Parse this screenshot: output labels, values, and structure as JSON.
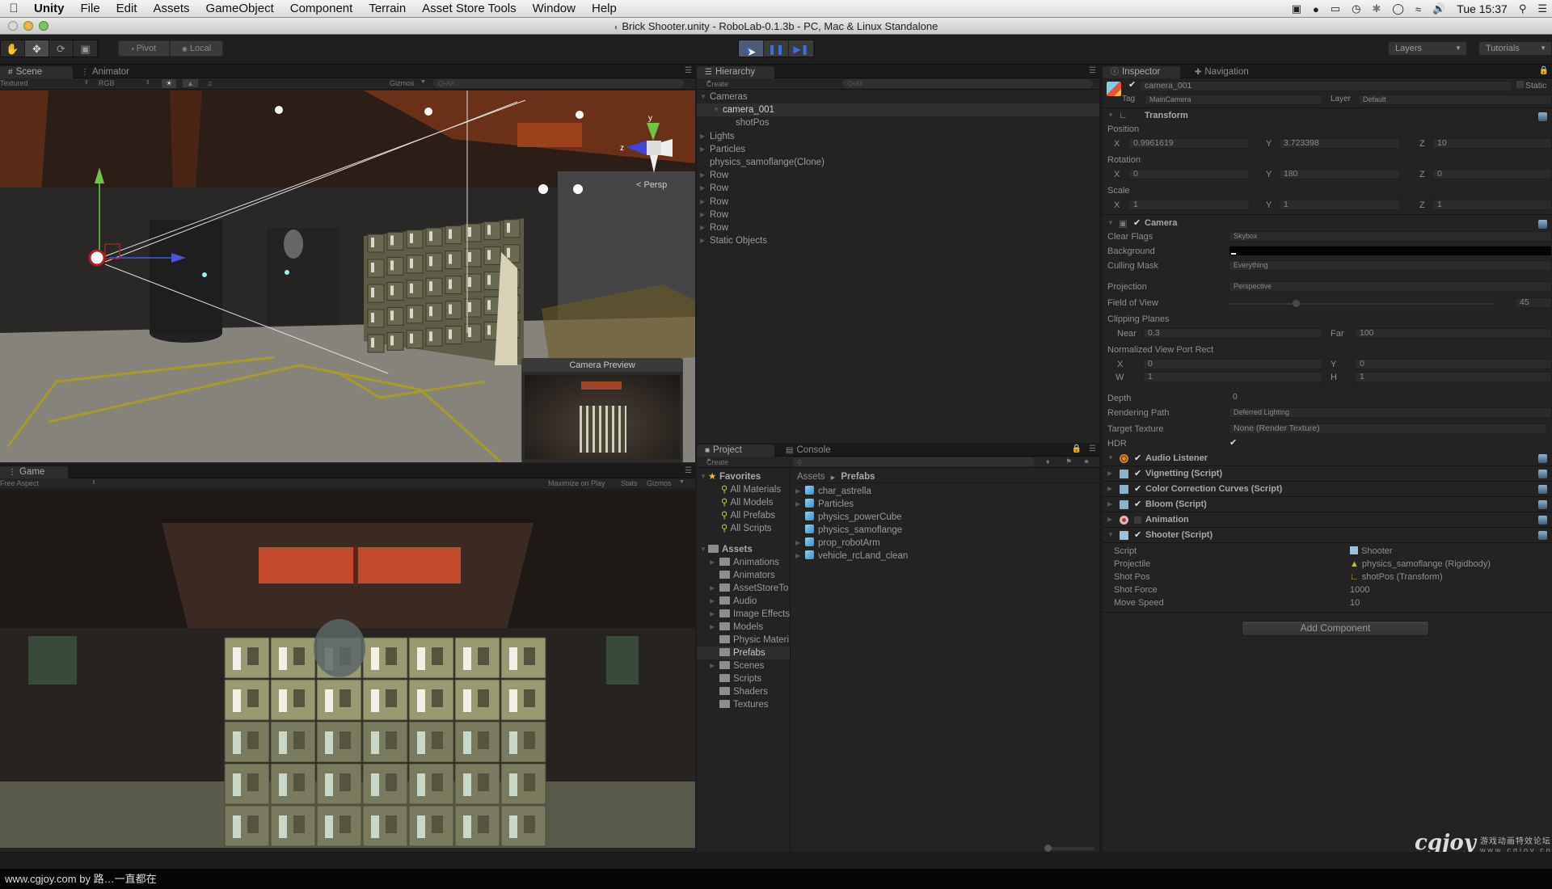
{
  "menubar": {
    "apple_icon": "apple-logo",
    "app_name": "Unity",
    "items": [
      "File",
      "Edit",
      "Assets",
      "GameObject",
      "Component",
      "Terrain",
      "Asset Store Tools",
      "Window",
      "Help"
    ],
    "status_icons": [
      "camera-record-icon",
      "skype-icon",
      "display-icon",
      "time-machine-icon",
      "bluetooth-icon",
      "messages-icon",
      "wifi-icon",
      "volume-icon"
    ],
    "clock": "Tue 15:37"
  },
  "window": {
    "title": "Brick Shooter.unity - RoboLab-0.1.3b - PC, Mac & Linux Standalone"
  },
  "toolbar": {
    "transform_tools": [
      "hand",
      "move",
      "rotate",
      "scale"
    ],
    "active_tool": "move",
    "pivot_label": "Pivot",
    "local_label": "Local",
    "play_state": "hover-play",
    "layers_label": "Layers",
    "tutorials_label": "Tutorials"
  },
  "scene": {
    "tabs": [
      {
        "label": "Scene",
        "active": true
      },
      {
        "label": "Animator",
        "active": false
      }
    ],
    "shading_mode": "Textured",
    "render_mode": "RGB",
    "gizmos_label": "Gizmos",
    "search_placeholder": "Q•All",
    "persp_label": "< Persp",
    "camera_preview_title": "Camera Preview",
    "axis_labels": {
      "y": "y",
      "z": "z"
    }
  },
  "game": {
    "tab_label": "Game",
    "aspect": "Free Aspect",
    "maximize_label": "Maximize on Play",
    "stats_label": "Stats",
    "gizmos_label": "Gizmos"
  },
  "hierarchy": {
    "tab_label": "Hierarchy",
    "create_label": "Create",
    "search_placeholder": "Q•All",
    "items": [
      {
        "label": "Cameras",
        "depth": 0,
        "expanded": true,
        "arrow": true
      },
      {
        "label": "camera_001",
        "depth": 1,
        "expanded": true,
        "arrow": true,
        "selected": true
      },
      {
        "label": "shotPos",
        "depth": 2,
        "arrow": false
      },
      {
        "label": "Lights",
        "depth": 0,
        "arrow": true
      },
      {
        "label": "Particles",
        "depth": 0,
        "arrow": true
      },
      {
        "label": "physics_samoflange(Clone)",
        "depth": 0,
        "arrow": false
      },
      {
        "label": "Row",
        "depth": 0,
        "arrow": true
      },
      {
        "label": "Row",
        "depth": 0,
        "arrow": true
      },
      {
        "label": "Row",
        "depth": 0,
        "arrow": true
      },
      {
        "label": "Row",
        "depth": 0,
        "arrow": true
      },
      {
        "label": "Row",
        "depth": 0,
        "arrow": true
      },
      {
        "label": "Static Objects",
        "depth": 0,
        "arrow": true
      }
    ]
  },
  "project": {
    "tabs": [
      {
        "label": "Project",
        "active": true
      },
      {
        "label": "Console",
        "active": false
      }
    ],
    "create_label": "Create",
    "favorites_label": "Favorites",
    "favorites": [
      "All Materials",
      "All Models",
      "All Prefabs",
      "All Scripts"
    ],
    "assets_label": "Assets",
    "folders": [
      {
        "label": "Animations",
        "arrow": true
      },
      {
        "label": "Animators",
        "arrow": false
      },
      {
        "label": "AssetStoreTo",
        "arrow": true
      },
      {
        "label": "Audio",
        "arrow": true
      },
      {
        "label": "Image Effects",
        "arrow": true
      },
      {
        "label": "Models",
        "arrow": true
      },
      {
        "label": "Physic Materi",
        "arrow": false
      },
      {
        "label": "Prefabs",
        "arrow": false,
        "selected": true
      },
      {
        "label": "Scenes",
        "arrow": true
      },
      {
        "label": "Scripts",
        "arrow": false
      },
      {
        "label": "Shaders",
        "arrow": false
      },
      {
        "label": "Textures",
        "arrow": false
      }
    ],
    "breadcrumb": [
      "Assets",
      "Prefabs"
    ],
    "prefabs": [
      {
        "label": "char_astrella",
        "arrow": true
      },
      {
        "label": "Particles",
        "arrow": true
      },
      {
        "label": "physics_powerCube",
        "arrow": false
      },
      {
        "label": "physics_samoflange",
        "arrow": false
      },
      {
        "label": "prop_robotArm",
        "arrow": true
      },
      {
        "label": "vehicle_rcLand_clean",
        "arrow": true
      }
    ]
  },
  "inspector": {
    "tabs": [
      {
        "label": "Inspector",
        "active": true
      },
      {
        "label": "Navigation",
        "active": false
      }
    ],
    "object_name": "camera_001",
    "object_enabled": true,
    "static_label": "Static",
    "tag_label": "Tag",
    "tag_value": "MainCamera",
    "layer_label": "Layer",
    "layer_value": "Default",
    "transform": {
      "title": "Transform",
      "position_label": "Position",
      "position": {
        "x": "0.9961619",
        "y": "3.723398",
        "z": "10"
      },
      "rotation_label": "Rotation",
      "rotation": {
        "x": "0",
        "y": "180",
        "z": "0"
      },
      "scale_label": "Scale",
      "scale": {
        "x": "1",
        "y": "1",
        "z": "1"
      }
    },
    "camera": {
      "title": "Camera",
      "enabled": true,
      "clear_flags_label": "Clear Flags",
      "clear_flags": "Skybox",
      "background_label": "Background",
      "background_color": "#000000",
      "culling_mask_label": "Culling Mask",
      "culling_mask": "Everything",
      "projection_label": "Projection",
      "projection": "Perspective",
      "fov_label": "Field of View",
      "fov": "45",
      "fov_slider_fraction": 0.24,
      "clipping_label": "Clipping Planes",
      "near_label": "Near",
      "near": "0.3",
      "far_label": "Far",
      "far": "100",
      "viewport_label": "Normalized View Port Rect",
      "vp_x": "0",
      "vp_y": "0",
      "vp_w": "1",
      "vp_h": "1",
      "depth_label": "Depth",
      "depth": "0",
      "rendering_path_label": "Rendering Path",
      "rendering_path": "Deferred Lighting",
      "target_texture_label": "Target Texture",
      "target_texture": "None (Render Texture)",
      "hdr_label": "HDR",
      "hdr": true
    },
    "components": [
      {
        "label": "Audio Listener",
        "icon": "audio-listener-icon",
        "enabled": true,
        "expanded": true
      },
      {
        "label": "Vignetting (Script)",
        "icon": "js-script-icon",
        "enabled": true,
        "expanded": false
      },
      {
        "label": "Color Correction Curves (Script)",
        "icon": "js-script-icon",
        "enabled": true,
        "expanded": false
      },
      {
        "label": "Bloom (Script)",
        "icon": "js-script-icon",
        "enabled": true,
        "expanded": false
      },
      {
        "label": "Animation",
        "icon": "animation-icon",
        "enabled": false,
        "expanded": false
      },
      {
        "label": "Shooter (Script)",
        "icon": "cs-script-icon",
        "enabled": true,
        "expanded": true
      }
    ],
    "shooter": {
      "script_label": "Script",
      "script": "Shooter",
      "projectile_label": "Projectile",
      "projectile": "physics_samoflange (Rigidbody)",
      "shotpos_label": "Shot Pos",
      "shotpos": "shotPos (Transform)",
      "shotforce_label": "Shot Force",
      "shotforce": "1000",
      "movespeed_label": "Move Speed",
      "movespeed": "10"
    },
    "add_component_label": "Add Component"
  },
  "watermark": {
    "logo_text": "cgjoy",
    "logo_sub": "游戏动画特效论坛",
    "logo_url_text": "www.cgjoy.com"
  },
  "footer": {
    "caption": "www.cgjoy.com by 路…一直都在"
  }
}
